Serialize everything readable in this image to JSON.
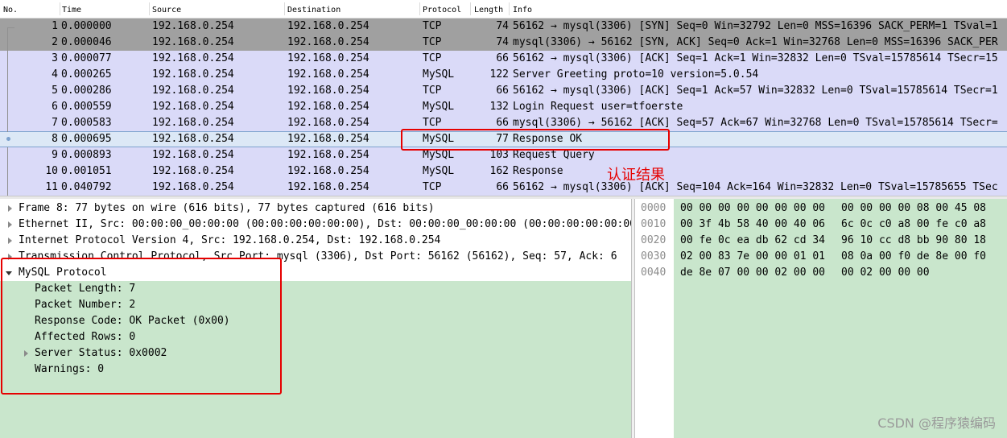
{
  "columns": [
    "No.",
    "Time",
    "Source",
    "Destination",
    "Protocol",
    "Length",
    "Info"
  ],
  "packets": [
    {
      "no": "1",
      "time": "0.000000",
      "source": "192.168.0.254",
      "destination": "192.168.0.254",
      "protocol": "TCP",
      "length": "74",
      "info": "56162 → mysql(3306) [SYN] Seq=0 Win=32792 Len=0 MSS=16396 SACK_PERM=1 TSval=1"
    },
    {
      "no": "2",
      "time": "0.000046",
      "source": "192.168.0.254",
      "destination": "192.168.0.254",
      "protocol": "TCP",
      "length": "74",
      "info": "mysql(3306) → 56162 [SYN, ACK] Seq=0 Ack=1 Win=32768 Len=0 MSS=16396 SACK_PER"
    },
    {
      "no": "3",
      "time": "0.000077",
      "source": "192.168.0.254",
      "destination": "192.168.0.254",
      "protocol": "TCP",
      "length": "66",
      "info": "56162 → mysql(3306) [ACK] Seq=1 Ack=1 Win=32832 Len=0 TSval=15785614 TSecr=15"
    },
    {
      "no": "4",
      "time": "0.000265",
      "source": "192.168.0.254",
      "destination": "192.168.0.254",
      "protocol": "MySQL",
      "length": "122",
      "info": "Server Greeting proto=10 version=5.0.54"
    },
    {
      "no": "5",
      "time": "0.000286",
      "source": "192.168.0.254",
      "destination": "192.168.0.254",
      "protocol": "TCP",
      "length": "66",
      "info": "56162 → mysql(3306) [ACK] Seq=1 Ack=57 Win=32832 Len=0 TSval=15785614 TSecr=1"
    },
    {
      "no": "6",
      "time": "0.000559",
      "source": "192.168.0.254",
      "destination": "192.168.0.254",
      "protocol": "MySQL",
      "length": "132",
      "info": "Login Request user=tfoerste"
    },
    {
      "no": "7",
      "time": "0.000583",
      "source": "192.168.0.254",
      "destination": "192.168.0.254",
      "protocol": "TCP",
      "length": "66",
      "info": "mysql(3306) → 56162 [ACK] Seq=57 Ack=67 Win=32768 Len=0 TSval=15785614 TSecr="
    },
    {
      "no": "8",
      "time": "0.000695",
      "source": "192.168.0.254",
      "destination": "192.168.0.254",
      "protocol": "MySQL",
      "length": "77",
      "info": "Response OK"
    },
    {
      "no": "9",
      "time": "0.000893",
      "source": "192.168.0.254",
      "destination": "192.168.0.254",
      "protocol": "MySQL",
      "length": "103",
      "info": "Request Query"
    },
    {
      "no": "10",
      "time": "0.001051",
      "source": "192.168.0.254",
      "destination": "192.168.0.254",
      "protocol": "MySQL",
      "length": "162",
      "info": "Response"
    },
    {
      "no": "11",
      "time": "0.040792",
      "source": "192.168.0.254",
      "destination": "192.168.0.254",
      "protocol": "TCP",
      "length": "66",
      "info": "56162 → mysql(3306) [ACK] Seq=104 Ack=164 Win=32832 Len=0 TSval=15785655 TSec"
    }
  ],
  "details": [
    "Frame 8: 77 bytes on wire (616 bits), 77 bytes captured (616 bits)",
    "Ethernet II, Src: 00:00:00_00:00:00 (00:00:00:00:00:00), Dst: 00:00:00_00:00:00 (00:00:00:00:00:00)",
    "Internet Protocol Version 4, Src: 192.168.0.254, Dst: 192.168.0.254",
    "Transmission Control Protocol, Src Port: mysql (3306), Dst Port: 56162 (56162), Seq: 57, Ack: 6",
    "MySQL Protocol",
    "Packet Length: 7",
    "Packet Number: 2",
    "Response Code: OK Packet (0x00)",
    "Affected Rows: 0",
    "Server Status: 0x0002",
    "Warnings: 0"
  ],
  "bytes": [
    {
      "offset": "0000",
      "hex1": "00 00 00 00 00 00 00 00",
      "hex2": "00 00 00 00 08 00 45 08"
    },
    {
      "offset": "0010",
      "hex1": "00 3f 4b 58 40 00 40 06",
      "hex2": "6c 0c c0 a8 00 fe c0 a8"
    },
    {
      "offset": "0020",
      "hex1": "00 fe 0c ea db 62 cd 34",
      "hex2": "96 10 cc d8 bb 90 80 18"
    },
    {
      "offset": "0030",
      "hex1": "02 00 83 7e 00 00 01 01",
      "hex2": "08 0a 00 f0 de 8e 00 f0"
    },
    {
      "offset": "0040",
      "hex1": "de 8e 07 00 00 02 00 00",
      "hex2": "00 02 00 00 00"
    }
  ],
  "annotation": "认证结果",
  "watermark": "CSDN @程序猿编码",
  "colors": {
    "annotation_red": "#e60000",
    "pane_green": "#c9e6cc",
    "tcp_gray": "#a0a0a0",
    "row_lavender": "#dadaf8",
    "selected_row": "#dce8f6"
  }
}
